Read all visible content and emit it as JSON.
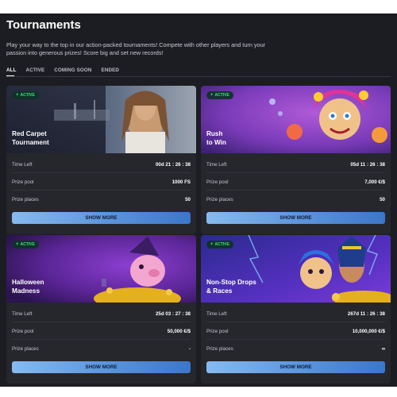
{
  "header": {
    "title": "Tournaments",
    "description": "Play your way to the top in our action-packed tournaments! Compete with other players and turn your passion into generous prizes! Score big and set new records!"
  },
  "tabs": [
    {
      "label": "ALL",
      "active": true
    },
    {
      "label": "ACTIVE",
      "active": false
    },
    {
      "label": "COMING SOON",
      "active": false
    },
    {
      "label": "ENDED",
      "active": false
    }
  ],
  "labels": {
    "time_left": "Time Left",
    "prize_pool": "Prize pool",
    "prize_places": "Prize places",
    "button": "SHOW MORE"
  },
  "tournaments": [
    {
      "badge": "ACTIVE",
      "name": "Red Carpet\nTournament",
      "time_left": "00d  21 : 26 : 38",
      "prize_pool": "1000 FS",
      "prize_places": "50"
    },
    {
      "badge": "ACTIVE",
      "name": "Rush\nto Win",
      "time_left": "05d  11 : 26 : 38",
      "prize_pool": "7,000 €/$",
      "prize_places": "50"
    },
    {
      "badge": "ACTIVE",
      "name": "Halloween\nMadness",
      "time_left": "25d  03 : 27 : 38",
      "prize_pool": "50,000 €/$",
      "prize_places": "-"
    },
    {
      "badge": "ACTIVE",
      "name": "Non-Stop Drops\n& Races",
      "time_left": "267d  11 : 26 : 38",
      "prize_pool": "10,000,000 €/$",
      "prize_places": "∞"
    }
  ],
  "colors": {
    "background": "#1c1d22",
    "card": "#26272d",
    "badge_text": "#3be27c",
    "button_start": "#86bbf0",
    "button_end": "#3c76c8"
  }
}
